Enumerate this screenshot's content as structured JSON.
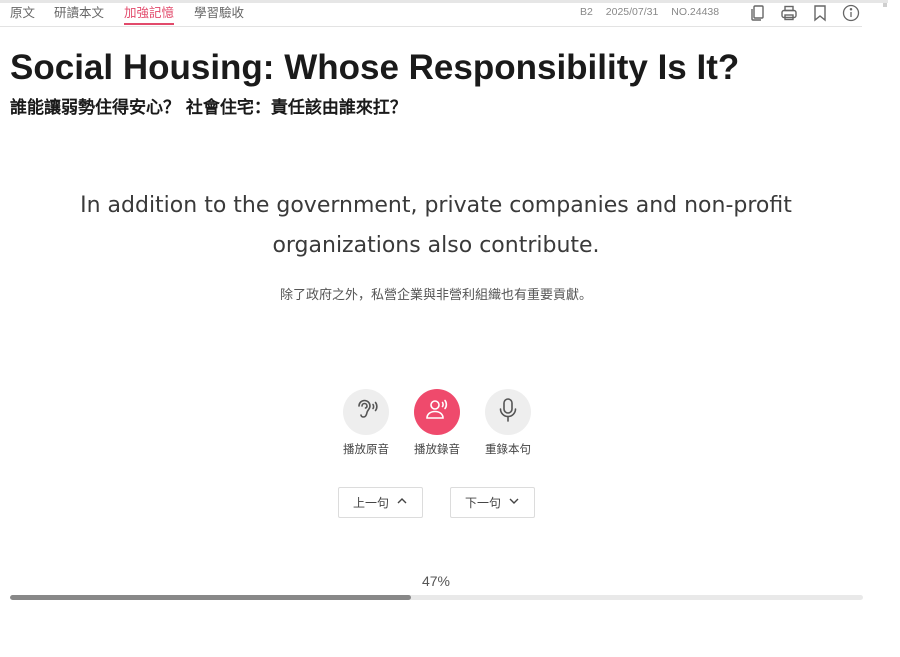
{
  "tabs": [
    {
      "label": "原文"
    },
    {
      "label": "研讀本文"
    },
    {
      "label": "加強記憶",
      "active": true
    },
    {
      "label": "學習驗收"
    }
  ],
  "meta": {
    "level": "B2",
    "date": "2025/07/31",
    "issue": "NO.24438"
  },
  "toolbar_icons": [
    "copy-icon",
    "print-icon",
    "bookmark-icon",
    "info-icon"
  ],
  "article": {
    "title": "Social Housing: Whose Responsibility Is It?",
    "subtitle": "誰能讓弱勢住得安心？ 社會住宅：責任該由誰來扛？"
  },
  "sentence": {
    "english": "In addition to the government, private companies and non-profit organizations also contribute.",
    "chinese": "除了政府之外，私營企業與非營利組織也有重要貢獻。"
  },
  "controls": {
    "play_original": "播放原音",
    "play_recording": "播放錄音",
    "rerecord": "重錄本句"
  },
  "navigation": {
    "prev": "上一句",
    "next": "下一句"
  },
  "progress": {
    "label": "47%",
    "value": 0.47
  },
  "colors": {
    "accent": "#e24a6b",
    "record_button": "#ef4a6c",
    "progress_fill": "#888888"
  }
}
